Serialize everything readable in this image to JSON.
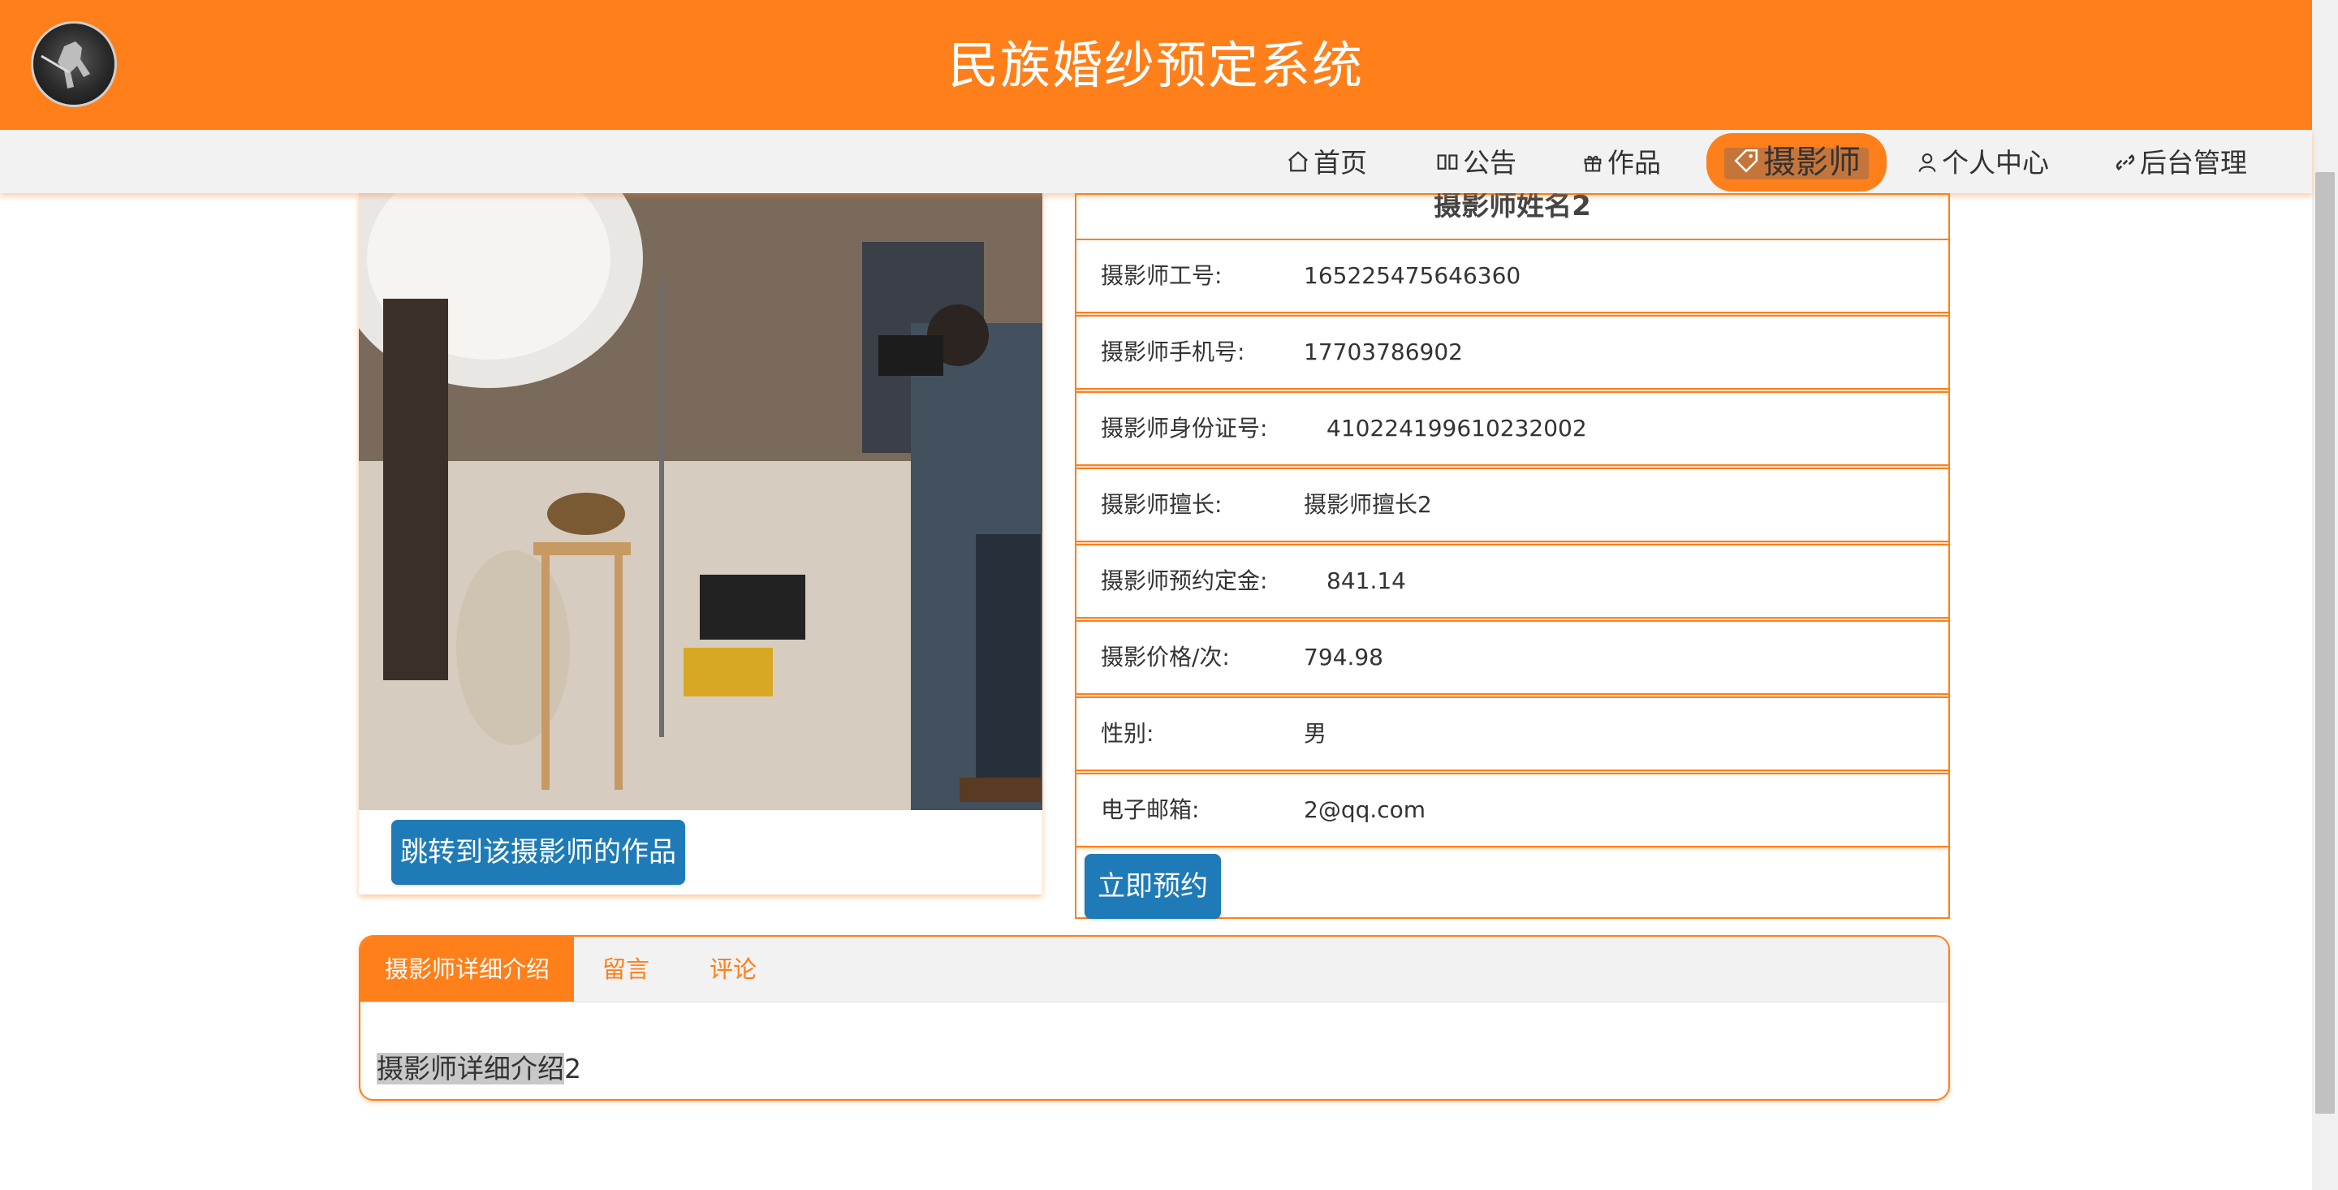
{
  "header": {
    "title": "民族婚纱预定系统"
  },
  "nav": {
    "items": [
      {
        "label": "首页",
        "icon": "home-icon"
      },
      {
        "label": "公告",
        "icon": "book-icon"
      },
      {
        "label": "作品",
        "icon": "gift-icon"
      },
      {
        "label": "摄影师",
        "icon": "tag-icon"
      },
      {
        "label": "个人中心",
        "icon": "user-icon"
      },
      {
        "label": "后台管理",
        "icon": "link-icon"
      }
    ],
    "active": "摄影师"
  },
  "photographer": {
    "name": "摄影师姓名2",
    "jump_button": "跳转到该摄影师的作品",
    "book_button": "立即预约",
    "fields": [
      {
        "label": "摄影师工号:",
        "value": "165225475646360"
      },
      {
        "label": "摄影师手机号:",
        "value": "17703786902"
      },
      {
        "label": "摄影师身份证号:",
        "value": "410224199610232002"
      },
      {
        "label": "摄影师擅长:",
        "value": "摄影师擅长2"
      },
      {
        "label": "摄影师预约定金:",
        "value": "841.14"
      },
      {
        "label": "摄影价格/次:",
        "value": "794.98"
      },
      {
        "label": "性别:",
        "value": "男"
      },
      {
        "label": "电子邮箱:",
        "value": "2@qq.com"
      }
    ]
  },
  "tabs": {
    "items": [
      "摄影师详细介绍",
      "留言",
      "评论"
    ],
    "active_index": 0,
    "content_highlight": "摄影师详细介绍",
    "content_suffix": "2"
  },
  "colors": {
    "accent": "#ff7f1a",
    "button": "#1e7bb8"
  }
}
